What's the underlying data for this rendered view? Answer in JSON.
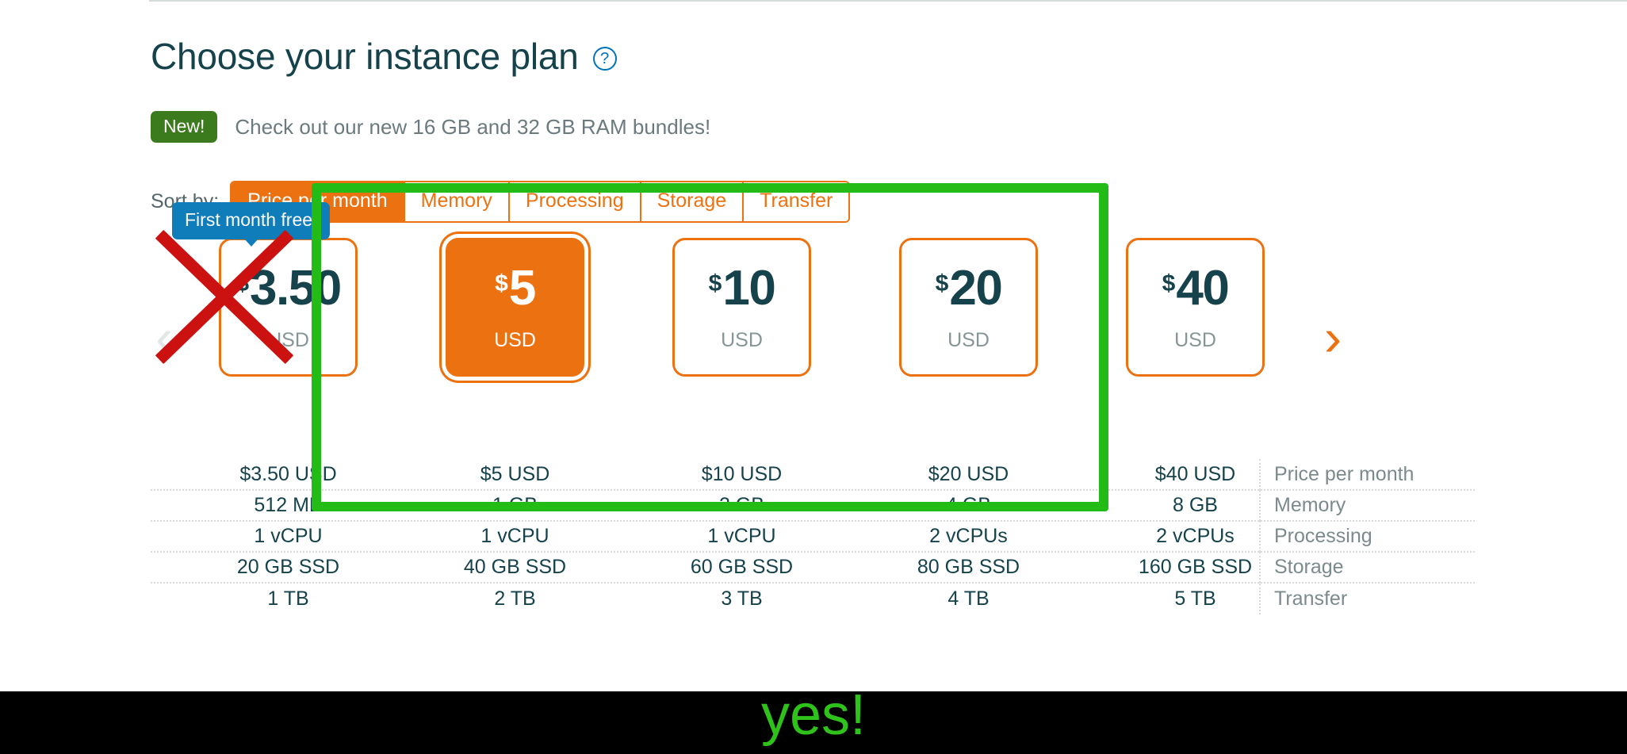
{
  "header": {
    "title": "Choose your instance plan",
    "help_icon": "question-circle-icon"
  },
  "promo": {
    "badge": "New!",
    "text": "Check out our new 16 GB and 32 GB RAM bundles!"
  },
  "sort": {
    "label": "Sort by:",
    "options": [
      {
        "label": "Price per month",
        "selected": true
      },
      {
        "label": "Memory",
        "selected": false
      },
      {
        "label": "Processing",
        "selected": false
      },
      {
        "label": "Storage",
        "selected": false
      },
      {
        "label": "Transfer",
        "selected": false
      }
    ]
  },
  "carousel": {
    "prev_icon": "chevron-left-icon",
    "next_icon": "chevron-right-icon",
    "free_badge": "First month free!"
  },
  "plans": [
    {
      "dollar": "$",
      "amount": "3.50",
      "currency": "USD",
      "selected": false,
      "badge": "First month free!"
    },
    {
      "dollar": "$",
      "amount": "5",
      "currency": "USD",
      "selected": true
    },
    {
      "dollar": "$",
      "amount": "10",
      "currency": "USD",
      "selected": false
    },
    {
      "dollar": "$",
      "amount": "20",
      "currency": "USD",
      "selected": false
    },
    {
      "dollar": "$",
      "amount": "40",
      "currency": "USD",
      "selected": false
    }
  ],
  "spec_table": {
    "row_labels": [
      "Price per month",
      "Memory",
      "Processing",
      "Storage",
      "Transfer"
    ],
    "rows": [
      {
        "label": "Price per month",
        "values": [
          "$3.50 USD",
          "$5 USD",
          "$10 USD",
          "$20 USD",
          "$40 USD"
        ]
      },
      {
        "label": "Memory",
        "values": [
          "512 MB",
          "1 GB",
          "2 GB",
          "4 GB",
          "8 GB"
        ]
      },
      {
        "label": "Processing",
        "values": [
          "1 vCPU",
          "1 vCPU",
          "1 vCPU",
          "2 vCPUs",
          "2 vCPUs"
        ]
      },
      {
        "label": "Storage",
        "values": [
          "20 GB SSD",
          "40 GB SSD",
          "60 GB SSD",
          "80 GB SSD",
          "160 GB SSD"
        ]
      },
      {
        "label": "Transfer",
        "values": [
          "1 TB",
          "2 TB",
          "3 TB",
          "4 TB",
          "5 TB"
        ]
      }
    ]
  },
  "annotations": {
    "caption": "yes!",
    "highlight_color": "#23bb16",
    "strike_color": "#cc1111",
    "caption_color": "#2ec21a"
  },
  "colors": {
    "accent_orange": "#ec7211",
    "dark_teal": "#16424c",
    "muted_gray": "#879596",
    "badge_green": "#3c7a1e",
    "badge_blue": "#0e7dba",
    "link_blue": "#0073bb"
  }
}
